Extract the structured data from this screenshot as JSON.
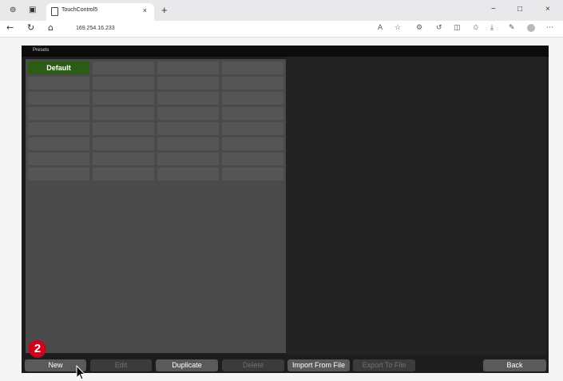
{
  "browser": {
    "tab_title": "TouchControl5",
    "tab_close": "×",
    "new_tab": "+",
    "url": "169.254.16.233",
    "window_controls": {
      "minimize": "−",
      "maximize": "□",
      "close": "×"
    },
    "toolbar_icons": [
      "read-aloud-icon",
      "favorite-star-icon",
      "extension-icon",
      "refresh-icon",
      "split-screen-icon",
      "favorites-icon",
      "download-icon",
      "copilot-icon",
      "profile-icon",
      "more-icon"
    ]
  },
  "app": {
    "header_title": "Presets",
    "presets": {
      "slots": [
        {
          "label": "Default",
          "active": true
        },
        {
          "label": "",
          "active": false
        },
        {
          "label": "",
          "active": false
        },
        {
          "label": "",
          "active": false
        },
        {
          "label": "",
          "active": false
        },
        {
          "label": "",
          "active": false
        },
        {
          "label": "",
          "active": false
        },
        {
          "label": "",
          "active": false
        },
        {
          "label": "",
          "active": false
        },
        {
          "label": "",
          "active": false
        },
        {
          "label": "",
          "active": false
        },
        {
          "label": "",
          "active": false
        },
        {
          "label": "",
          "active": false
        },
        {
          "label": "",
          "active": false
        },
        {
          "label": "",
          "active": false
        },
        {
          "label": "",
          "active": false
        },
        {
          "label": "",
          "active": false
        },
        {
          "label": "",
          "active": false
        },
        {
          "label": "",
          "active": false
        },
        {
          "label": "",
          "active": false
        },
        {
          "label": "",
          "active": false
        },
        {
          "label": "",
          "active": false
        },
        {
          "label": "",
          "active": false
        },
        {
          "label": "",
          "active": false
        },
        {
          "label": "",
          "active": false
        },
        {
          "label": "",
          "active": false
        },
        {
          "label": "",
          "active": false
        },
        {
          "label": "",
          "active": false
        },
        {
          "label": "",
          "active": false
        },
        {
          "label": "",
          "active": false
        },
        {
          "label": "",
          "active": false
        },
        {
          "label": "",
          "active": false
        }
      ]
    },
    "step_badge": "2",
    "buttons": {
      "new": {
        "label": "New",
        "enabled": true
      },
      "edit": {
        "label": "Edit",
        "enabled": false
      },
      "duplicate": {
        "label": "Duplicate",
        "enabled": true
      },
      "delete": {
        "label": "Delete",
        "enabled": false
      },
      "import": {
        "label": "Import From File",
        "enabled": true
      },
      "export": {
        "label": "Export To File",
        "enabled": false
      },
      "back": {
        "label": "Back",
        "enabled": true
      }
    }
  },
  "colors": {
    "active_preset": "#2b5c14",
    "badge": "#d0021b",
    "app_background": "#1d1d1d",
    "preset_panel": "#4a4a4a"
  }
}
